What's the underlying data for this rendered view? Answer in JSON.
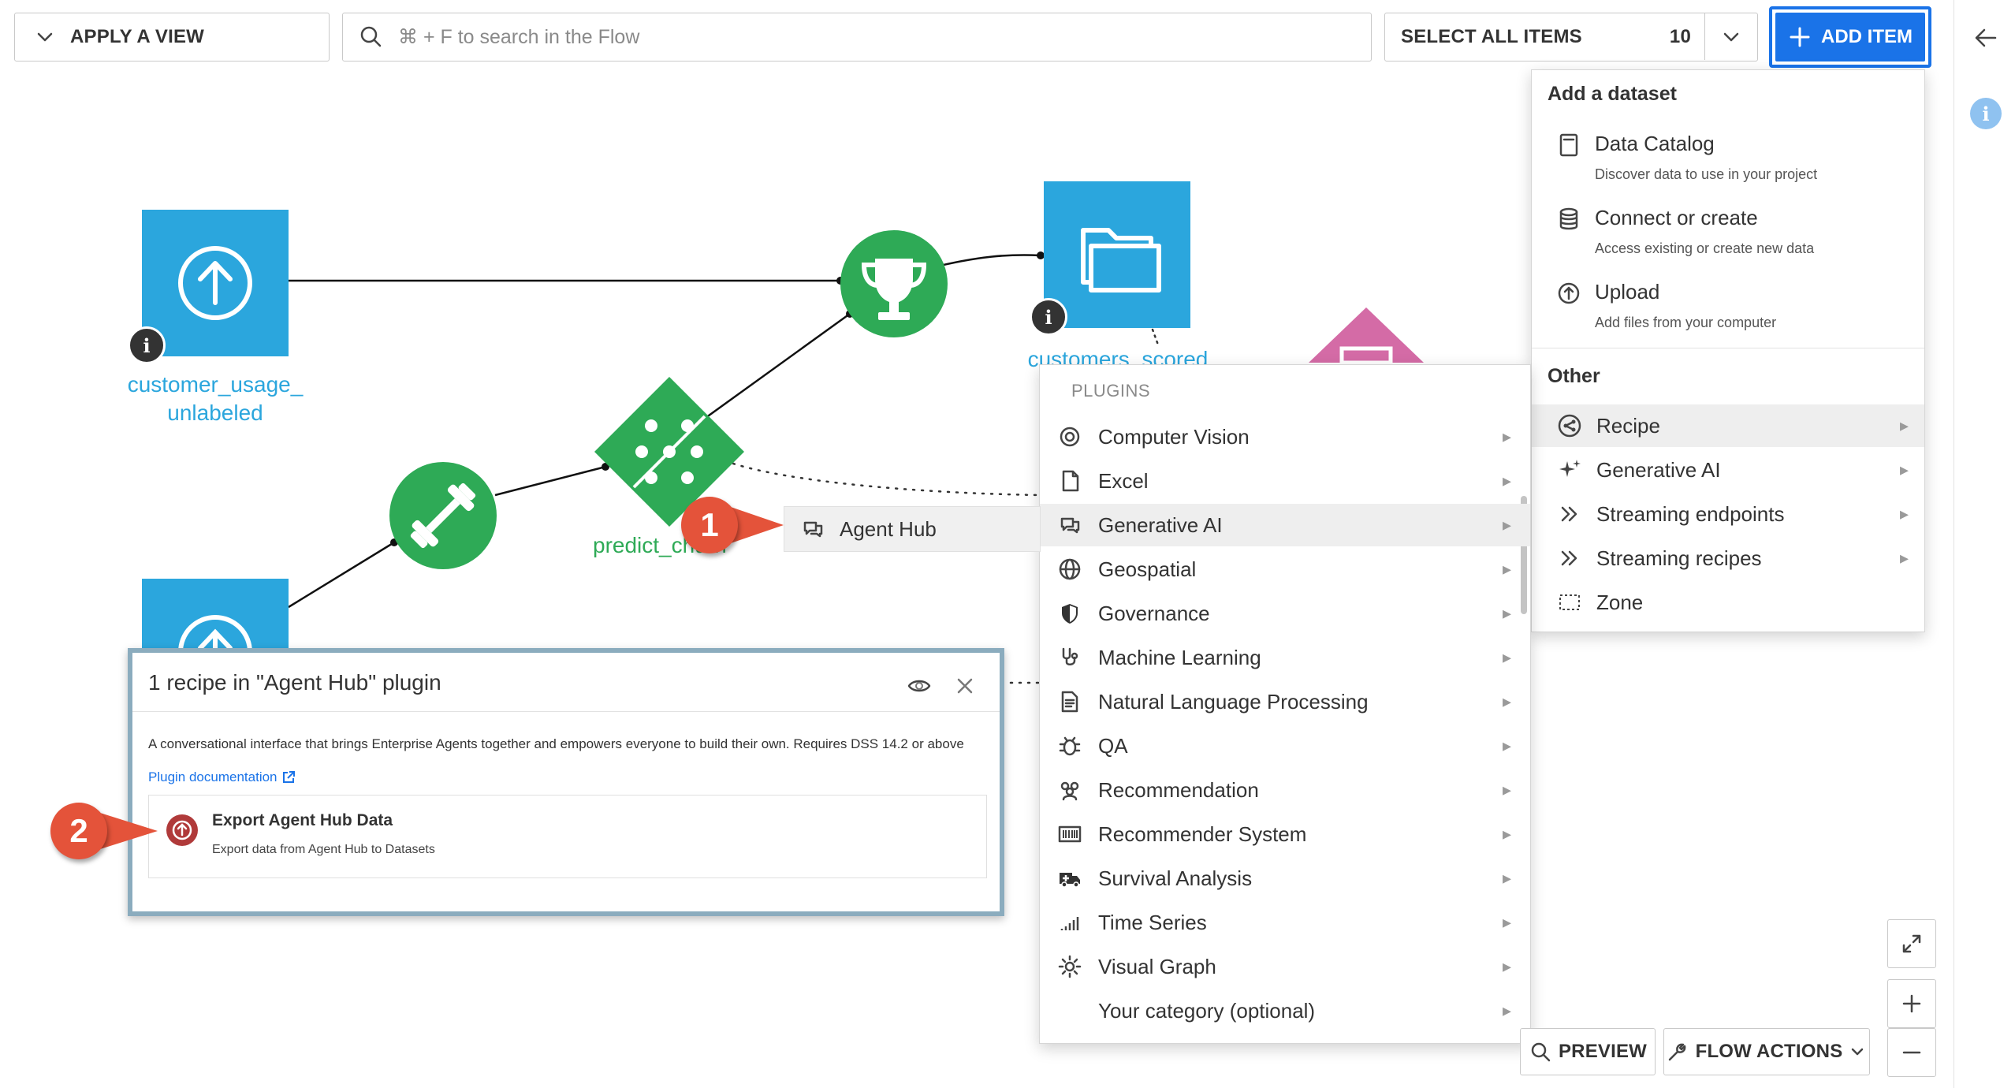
{
  "topbar": {
    "apply_view_label": "APPLY A VIEW",
    "search_placeholder": "⌘ + F to search in the Flow",
    "select_all_label": "SELECT ALL ITEMS",
    "select_count": "10",
    "add_item_label": "ADD ITEM"
  },
  "flow": {
    "nodes": {
      "upload_dataset_label_line1": "customer_usage_",
      "upload_dataset_label_line2": "unlabeled",
      "scored_dataset_label": "customers_scored",
      "model_label": "predict_churn"
    }
  },
  "add_menu": {
    "section_dataset": "Add a dataset",
    "items": [
      {
        "label": "Data Catalog",
        "desc": "Discover data to use in your project",
        "icon": "book-icon"
      },
      {
        "label": "Connect or create",
        "desc": "Access existing or create new data",
        "icon": "database-icon"
      },
      {
        "label": "Upload",
        "desc": "Add files from your computer",
        "icon": "upload-icon"
      }
    ],
    "section_other": "Other",
    "other_items": [
      {
        "label": "Recipe",
        "icon": "recipe-icon"
      },
      {
        "label": "Generative AI",
        "icon": "sparkle-icon"
      },
      {
        "label": "Streaming endpoints",
        "icon": "stream-icon"
      },
      {
        "label": "Streaming recipes",
        "icon": "stream-icon"
      },
      {
        "label": "Zone",
        "icon": "zone-icon"
      }
    ]
  },
  "plugins_menu": {
    "header": "PLUGINS",
    "items": [
      {
        "label": "Computer Vision"
      },
      {
        "label": "Excel"
      },
      {
        "label": "Generative AI"
      },
      {
        "label": "Geospatial"
      },
      {
        "label": "Governance"
      },
      {
        "label": "Machine Learning"
      },
      {
        "label": "Natural Language Processing"
      },
      {
        "label": "QA"
      },
      {
        "label": "Recommendation"
      },
      {
        "label": "Recommender System"
      },
      {
        "label": "Survival Analysis"
      },
      {
        "label": "Time Series"
      },
      {
        "label": "Visual Graph"
      },
      {
        "label": "Your category (optional)"
      }
    ]
  },
  "submenu": {
    "agent_hub_label": "Agent Hub"
  },
  "popover": {
    "title": "1 recipe in \"Agent Hub\" plugin",
    "description": "A conversational interface that brings Enterprise Agents together and empowers everyone to build their own. Requires DSS 14.2 or above",
    "doc_link": "Plugin documentation",
    "recipe_title": "Export Agent Hub Data",
    "recipe_desc": "Export data from Agent Hub to Datasets"
  },
  "callouts": {
    "one": "1",
    "two": "2"
  },
  "bottom": {
    "preview_label": "PREVIEW",
    "flow_actions_label": "FLOW ACTIONS"
  },
  "colors": {
    "accent": "#1a73e8",
    "dataset_blue": "#2ba6dd",
    "recipe_green": "#2eaa56",
    "callout_red": "#e4533a",
    "popover_border": "#8bacbe"
  }
}
